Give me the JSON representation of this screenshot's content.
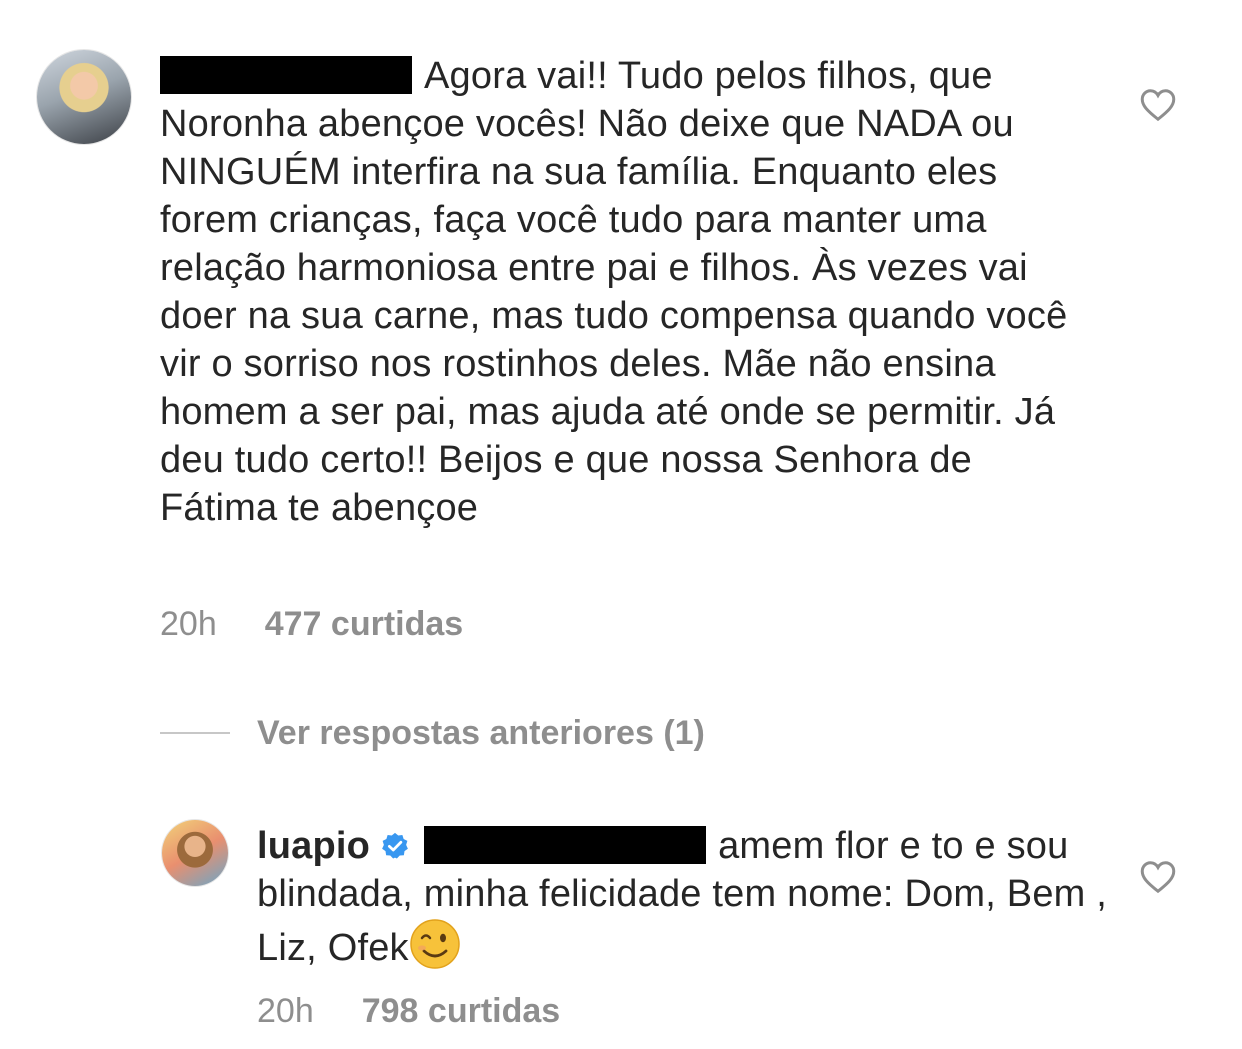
{
  "comments": [
    {
      "username_redacted": true,
      "text": "Agora vai!! Tudo pelos filhos, que Noronha abençoe vocês! Não deixe que NADA ou NINGUÉM interfira na sua família. Enquanto eles forem crianças, faça você tudo para manter uma relação harmoniosa entre pai e filhos. Às vezes vai doer na sua carne, mas tudo compensa quando você vir o sorriso nos rostinhos deles. Mãe não ensina homem a ser pai, mas ajuda até onde se permitir. Já deu tudo certo!! Beijos e que nossa Senhora de Fátima te abençoe",
      "time": "20h",
      "likes": "477 curtidas"
    },
    {
      "username": "luapio",
      "verified": true,
      "mention_redacted": true,
      "text": "amem flor e to e sou blindada, minha felicidade tem nome: Dom, Bem , Liz, Ofek",
      "emoji": "winking-face",
      "time": "20h",
      "likes": "798 curtidas"
    }
  ],
  "replies_toggle": "Ver respostas anteriores (1)",
  "icons": {
    "like": "heart-icon",
    "verified": "verified-badge-icon"
  },
  "colors": {
    "text": "#262626",
    "meta": "#8e8e8e",
    "verified": "#3897f0"
  }
}
